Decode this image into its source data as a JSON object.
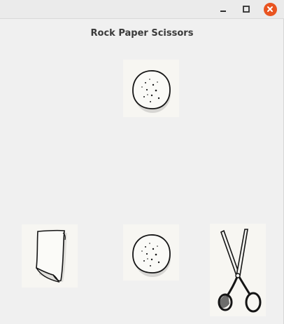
{
  "window": {
    "title": "Rock Paper Scissors",
    "controls": {
      "minimize_icon": "minimize-icon",
      "maximize_icon": "maximize-icon",
      "close_icon": "close-icon",
      "close_color": "#e95420"
    }
  },
  "computer_choice": {
    "icon": "rock-icon"
  },
  "player_choices": [
    {
      "icon": "paper-icon"
    },
    {
      "icon": "rock-icon"
    },
    {
      "icon": "scissors-icon"
    }
  ]
}
